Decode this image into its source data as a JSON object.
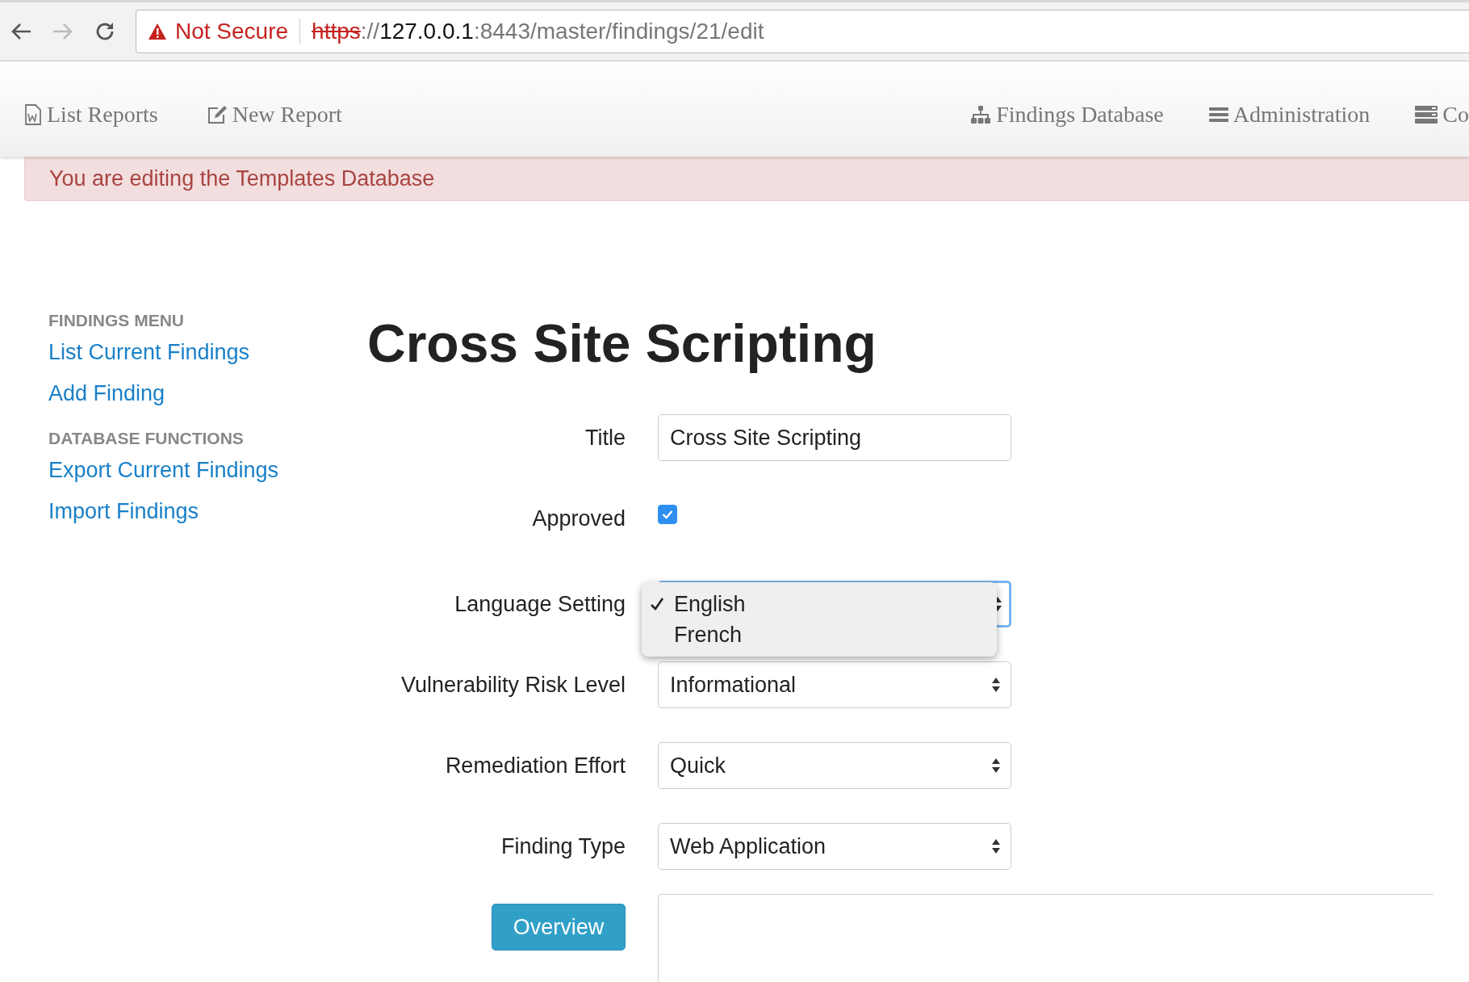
{
  "browser": {
    "security": "Not Secure",
    "url_scheme": "https",
    "url_sep": "://",
    "url_host": "127.0.0.1",
    "url_rest": ":8443/master/findings/21/edit"
  },
  "nav": {
    "left": [
      {
        "label": "List Reports"
      },
      {
        "label": "New Report"
      }
    ],
    "right": [
      {
        "label": "Findings Database"
      },
      {
        "label": "Administration"
      },
      {
        "label": "Co"
      }
    ]
  },
  "alert": "You are editing the Templates Database",
  "sidebar": [
    {
      "kind": "header",
      "label": "FINDINGS MENU"
    },
    {
      "kind": "link",
      "label": "List Current Findings"
    },
    {
      "kind": "link",
      "label": "Add Finding"
    },
    {
      "kind": "header",
      "label": "DATABASE FUNCTIONS"
    },
    {
      "kind": "link",
      "label": "Export Current Findings"
    },
    {
      "kind": "link",
      "label": "Import Findings"
    }
  ],
  "heading": "Cross Site Scripting",
  "form": [
    {
      "kind": "text",
      "label": "Title",
      "value": "Cross Site Scripting"
    },
    {
      "kind": "checkbox",
      "label": "Approved",
      "checked": true
    },
    {
      "kind": "open_select",
      "label": "Language Setting",
      "options": [
        {
          "label": "English",
          "selected": true
        },
        {
          "label": "French",
          "selected": false
        }
      ]
    },
    {
      "kind": "select",
      "label": "Vulnerability Risk Level",
      "value": "Informational"
    },
    {
      "kind": "select",
      "label": "Remediation Effort",
      "value": "Quick"
    },
    {
      "kind": "select",
      "label": "Finding Type",
      "value": "Web Application"
    }
  ],
  "overview_button": "Overview"
}
